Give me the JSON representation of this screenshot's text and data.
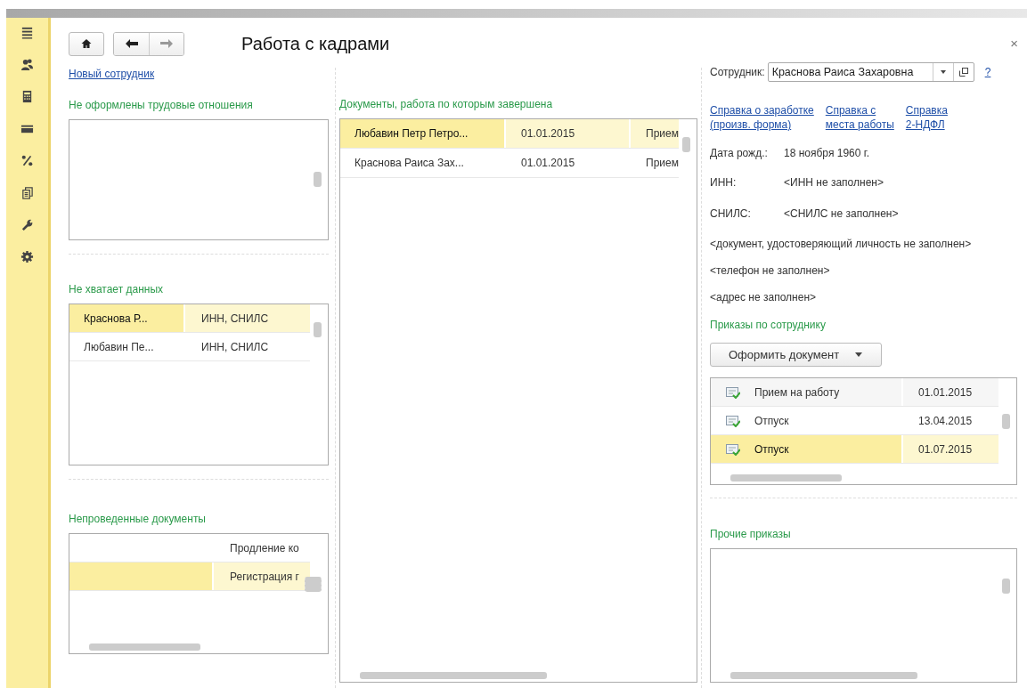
{
  "window": {
    "title": "Работа с кадрами",
    "close": "×"
  },
  "sidebar": {
    "items": [
      {
        "kind": "menu"
      },
      {
        "kind": "people"
      },
      {
        "kind": "calculator"
      },
      {
        "kind": "card"
      },
      {
        "kind": "percent"
      },
      {
        "kind": "documents"
      },
      {
        "kind": "wrench"
      },
      {
        "kind": "gear"
      }
    ]
  },
  "new_employee_link": "Новый сотрудник",
  "not_registered": {
    "title": "Не оформлены трудовые отношения"
  },
  "missing_data": {
    "title": "Не хватает данных",
    "rows": [
      {
        "name": "Краснова Р...",
        "missing": "ИНН, СНИЛС",
        "selected": true
      },
      {
        "name": "Любавин Пе...",
        "missing": "ИНН, СНИЛС",
        "selected": false
      }
    ]
  },
  "unposted": {
    "title": "Непроведенные документы",
    "rows": [
      {
        "document": "Продление ко",
        "selected": false
      },
      {
        "document": "Регистрация г",
        "selected": true
      }
    ]
  },
  "completed": {
    "title": "Документы, работа по которым завершена",
    "rows": [
      {
        "name": "Любавин Петр Петро...",
        "date": "01.01.2015",
        "document": "Прием",
        "selected": true
      },
      {
        "name": "Краснова Раиса Зах...",
        "date": "01.01.2015",
        "document": "Прием",
        "selected": false
      }
    ]
  },
  "employee": {
    "label": "Сотрудник:",
    "value": "Краснова Раиса Захаровна",
    "help": "?",
    "links": [
      [
        "Справка о заработке",
        "(произв. форма)"
      ],
      [
        "Справка с",
        "места работы"
      ],
      [
        "Справка",
        "2-НДФЛ"
      ]
    ],
    "info": [
      {
        "label": "Дата рожд.:",
        "value": "18 ноября 1960 г."
      },
      {
        "label": "ИНН:",
        "value": "<ИНН не заполнен>"
      },
      {
        "label": "СНИЛС:",
        "value": "<СНИЛС не заполнен>"
      }
    ],
    "notes": [
      "<документ, удостоверяющий личность не заполнен>",
      "<телефон не заполнен>",
      "<адрес не заполнен>"
    ]
  },
  "orders": {
    "title": "Приказы по сотруднику",
    "button": "Оформить документ",
    "rows": [
      {
        "name": "Прием на работу",
        "date": "01.01.2015",
        "selected": false
      },
      {
        "name": "Отпуск",
        "date": "13.04.2015",
        "selected": false
      },
      {
        "name": "Отпуск",
        "date": "01.07.2015",
        "selected": true
      }
    ]
  },
  "other_orders": {
    "title": "Прочие приказы"
  }
}
